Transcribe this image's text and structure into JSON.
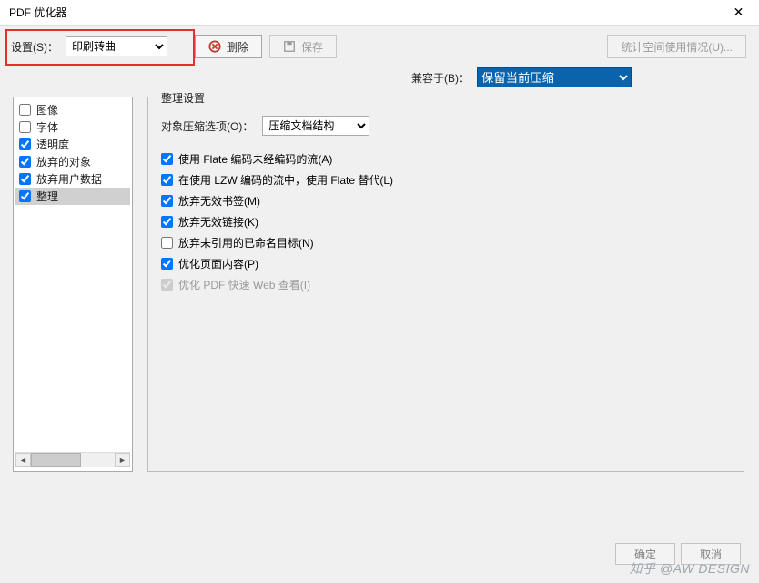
{
  "window": {
    "title": "PDF 优化器"
  },
  "toolbar": {
    "settings_label": "设置(S)：",
    "settings_value": "印刷转曲",
    "delete_label": "删除",
    "save_label": "保存",
    "stats_label": "统计空间使用情况(U)..."
  },
  "compat": {
    "label": "兼容于(B)：",
    "value": "保留当前压缩"
  },
  "tree": {
    "items": [
      {
        "label": "图像",
        "checked": false
      },
      {
        "label": "字体",
        "checked": false
      },
      {
        "label": "透明度",
        "checked": true
      },
      {
        "label": "放弃的对象",
        "checked": true
      },
      {
        "label": "放弃用户数据",
        "checked": true
      },
      {
        "label": "整理",
        "checked": true,
        "selected": true
      }
    ]
  },
  "panel": {
    "title": "整理设置",
    "compress_label": "对象压缩选项(O)：",
    "compress_value": "压缩文档结构",
    "checks": [
      {
        "label": "使用 Flate 编码未经编码的流(A)",
        "checked": true
      },
      {
        "label": "在使用 LZW 编码的流中，使用 Flate 替代(L)",
        "checked": true
      },
      {
        "label": "放弃无效书签(M)",
        "checked": true
      },
      {
        "label": "放弃无效链接(K)",
        "checked": true
      },
      {
        "label": "放弃未引用的已命名目标(N)",
        "checked": false
      },
      {
        "label": "优化页面内容(P)",
        "checked": true
      },
      {
        "label": "优化 PDF 快速 Web 查看(I)",
        "checked": true,
        "disabled": true
      }
    ]
  },
  "footer": {
    "ok": "确定",
    "cancel": "取消"
  },
  "watermark": "知乎 @AW DESIGN"
}
